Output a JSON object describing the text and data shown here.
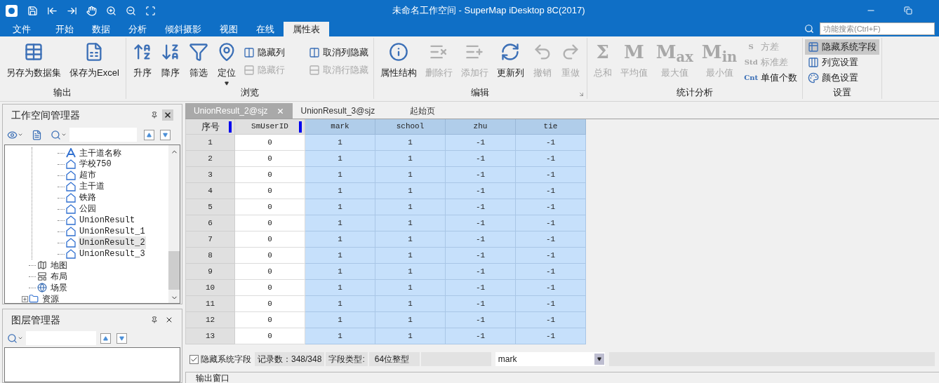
{
  "window": {
    "title": "未命名工作空间 - SuperMap iDesktop 8C(2017)"
  },
  "menu_tabs": [
    {
      "label": "文件",
      "selected": false
    },
    {
      "label": "开始",
      "selected": false
    },
    {
      "label": "数据",
      "selected": false
    },
    {
      "label": "分析",
      "selected": false
    },
    {
      "label": "倾斜摄影",
      "selected": false
    },
    {
      "label": "视图",
      "selected": false
    },
    {
      "label": "在线",
      "selected": false
    },
    {
      "label": "属性表",
      "selected": true
    }
  ],
  "search": {
    "placeholder": "功能搜索(Ctrl+F)"
  },
  "ribbon": [
    {
      "label": "输出",
      "launcher": false,
      "buttons": [
        {
          "label": "另存为数据集",
          "disabled": false
        },
        {
          "label": "保存为Excel",
          "disabled": false
        }
      ]
    },
    {
      "label": "浏览",
      "launcher": false,
      "buttons": [
        {
          "label": "升序",
          "disabled": false,
          "dropdown": false
        },
        {
          "label": "降序",
          "disabled": false,
          "dropdown": false
        },
        {
          "label": "筛选",
          "disabled": false,
          "dropdown": false
        },
        {
          "label": "定位",
          "disabled": false,
          "dropdown": true
        }
      ],
      "small_buttons": [
        {
          "label": "隐藏列",
          "disabled": false
        },
        {
          "label": "取消列隐藏",
          "disabled": false
        },
        {
          "label": "隐藏行",
          "disabled": true
        },
        {
          "label": "取消行隐藏",
          "disabled": true
        }
      ]
    },
    {
      "label": "编辑",
      "launcher": true,
      "buttons": [
        {
          "label": "属性结构",
          "disabled": false
        },
        {
          "label": "删除行",
          "disabled": true
        },
        {
          "label": "添加行",
          "disabled": true
        },
        {
          "label": "更新列",
          "disabled": false
        },
        {
          "label": "撤销",
          "disabled": true
        },
        {
          "label": "重做",
          "disabled": true
        }
      ]
    },
    {
      "label": "统计分析",
      "launcher": false,
      "buttons": [
        {
          "label": "总和",
          "disabled": true,
          "glyph": "Σ"
        },
        {
          "label": "平均值",
          "disabled": true,
          "glyph": "M"
        },
        {
          "label": "最大值",
          "disabled": true,
          "glyph": "M$_{ax}$"
        },
        {
          "label": "最小值",
          "disabled": true,
          "glyph": "M$_{in}$"
        }
      ],
      "small_buttons": [
        {
          "label": "方差",
          "disabled": true,
          "glyph": "S"
        },
        {
          "label": "标准差",
          "disabled": true,
          "glyph": "Std"
        },
        {
          "label": "单值个数",
          "disabled": false,
          "glyph": "Cnt"
        }
      ]
    },
    {
      "label": "设置",
      "launcher": false,
      "small_buttons": [
        {
          "label": "隐藏系统字段",
          "disabled": false,
          "selected": true
        },
        {
          "label": "列宽设置",
          "disabled": false,
          "selected": false
        },
        {
          "label": "颜色设置",
          "disabled": false,
          "selected": false
        }
      ]
    }
  ],
  "workspace_manager": {
    "title": "工作空间管理器",
    "tree": [
      {
        "kind": "group",
        "children": [
          {
            "label": "主干道名称",
            "kind": "text",
            "selected": false
          },
          {
            "label": "学校750",
            "kind": "region",
            "selected": false
          },
          {
            "label": "超市",
            "kind": "region",
            "selected": false
          },
          {
            "label": "主干道",
            "kind": "region",
            "selected": false
          },
          {
            "label": "铁路",
            "kind": "region",
            "selected": false
          },
          {
            "label": "公园",
            "kind": "region",
            "selected": false
          },
          {
            "label": "UnionResult",
            "kind": "region",
            "selected": false
          },
          {
            "label": "UnionResult_1",
            "kind": "region",
            "selected": false
          },
          {
            "label": "UnionResult_2",
            "kind": "region",
            "selected": true
          },
          {
            "label": "UnionResult_3",
            "kind": "region",
            "selected": false
          }
        ]
      },
      {
        "label": "地图",
        "kind": "map",
        "selected": false
      },
      {
        "label": "布局",
        "kind": "layout",
        "selected": false
      },
      {
        "label": "场景",
        "kind": "scene",
        "selected": false
      },
      {
        "label": "资源",
        "kind": "folder",
        "selected": false,
        "expanded": false
      }
    ]
  },
  "layer_manager": {
    "title": "图层管理器"
  },
  "doc_tabs": [
    {
      "label": "UnionResult_2@sjz",
      "selected": true
    },
    {
      "label": "UnionResult_3@sjz",
      "selected": false
    },
    {
      "label": "起始页",
      "selected": false
    }
  ],
  "table": {
    "columns": [
      {
        "label": "序号",
        "selected": false
      },
      {
        "label": "SmUserID",
        "selected": false
      },
      {
        "label": "mark",
        "selected": true
      },
      {
        "label": "school",
        "selected": true
      },
      {
        "label": "zhu",
        "selected": true
      },
      {
        "label": "tie",
        "selected": true
      }
    ],
    "rows": [
      {
        "cells": [
          "1",
          "0",
          "1",
          "1",
          "-1",
          "-1"
        ]
      },
      {
        "cells": [
          "2",
          "0",
          "1",
          "1",
          "-1",
          "-1"
        ]
      },
      {
        "cells": [
          "3",
          "0",
          "1",
          "1",
          "-1",
          "-1"
        ]
      },
      {
        "cells": [
          "4",
          "0",
          "1",
          "1",
          "-1",
          "-1"
        ]
      },
      {
        "cells": [
          "5",
          "0",
          "1",
          "1",
          "-1",
          "-1"
        ]
      },
      {
        "cells": [
          "6",
          "0",
          "1",
          "1",
          "-1",
          "-1"
        ]
      },
      {
        "cells": [
          "7",
          "0",
          "1",
          "1",
          "-1",
          "-1"
        ]
      },
      {
        "cells": [
          "8",
          "0",
          "1",
          "1",
          "-1",
          "-1"
        ]
      },
      {
        "cells": [
          "9",
          "0",
          "1",
          "1",
          "-1",
          "-1"
        ]
      },
      {
        "cells": [
          "10",
          "0",
          "1",
          "1",
          "-1",
          "-1"
        ]
      },
      {
        "cells": [
          "11",
          "0",
          "1",
          "1",
          "-1",
          "-1"
        ]
      },
      {
        "cells": [
          "12",
          "0",
          "1",
          "1",
          "-1",
          "-1"
        ]
      },
      {
        "cells": [
          "13",
          "0",
          "1",
          "1",
          "-1",
          "-1"
        ]
      }
    ]
  },
  "status_bar": {
    "checkbox": {
      "label": "隐藏系统字段",
      "checked": true
    },
    "records": "记录数：348/348",
    "type_label": "字段类型:",
    "type_value": "64位整型",
    "field_select": {
      "value": "mark"
    }
  },
  "output_window": {
    "title": "输出窗口"
  }
}
